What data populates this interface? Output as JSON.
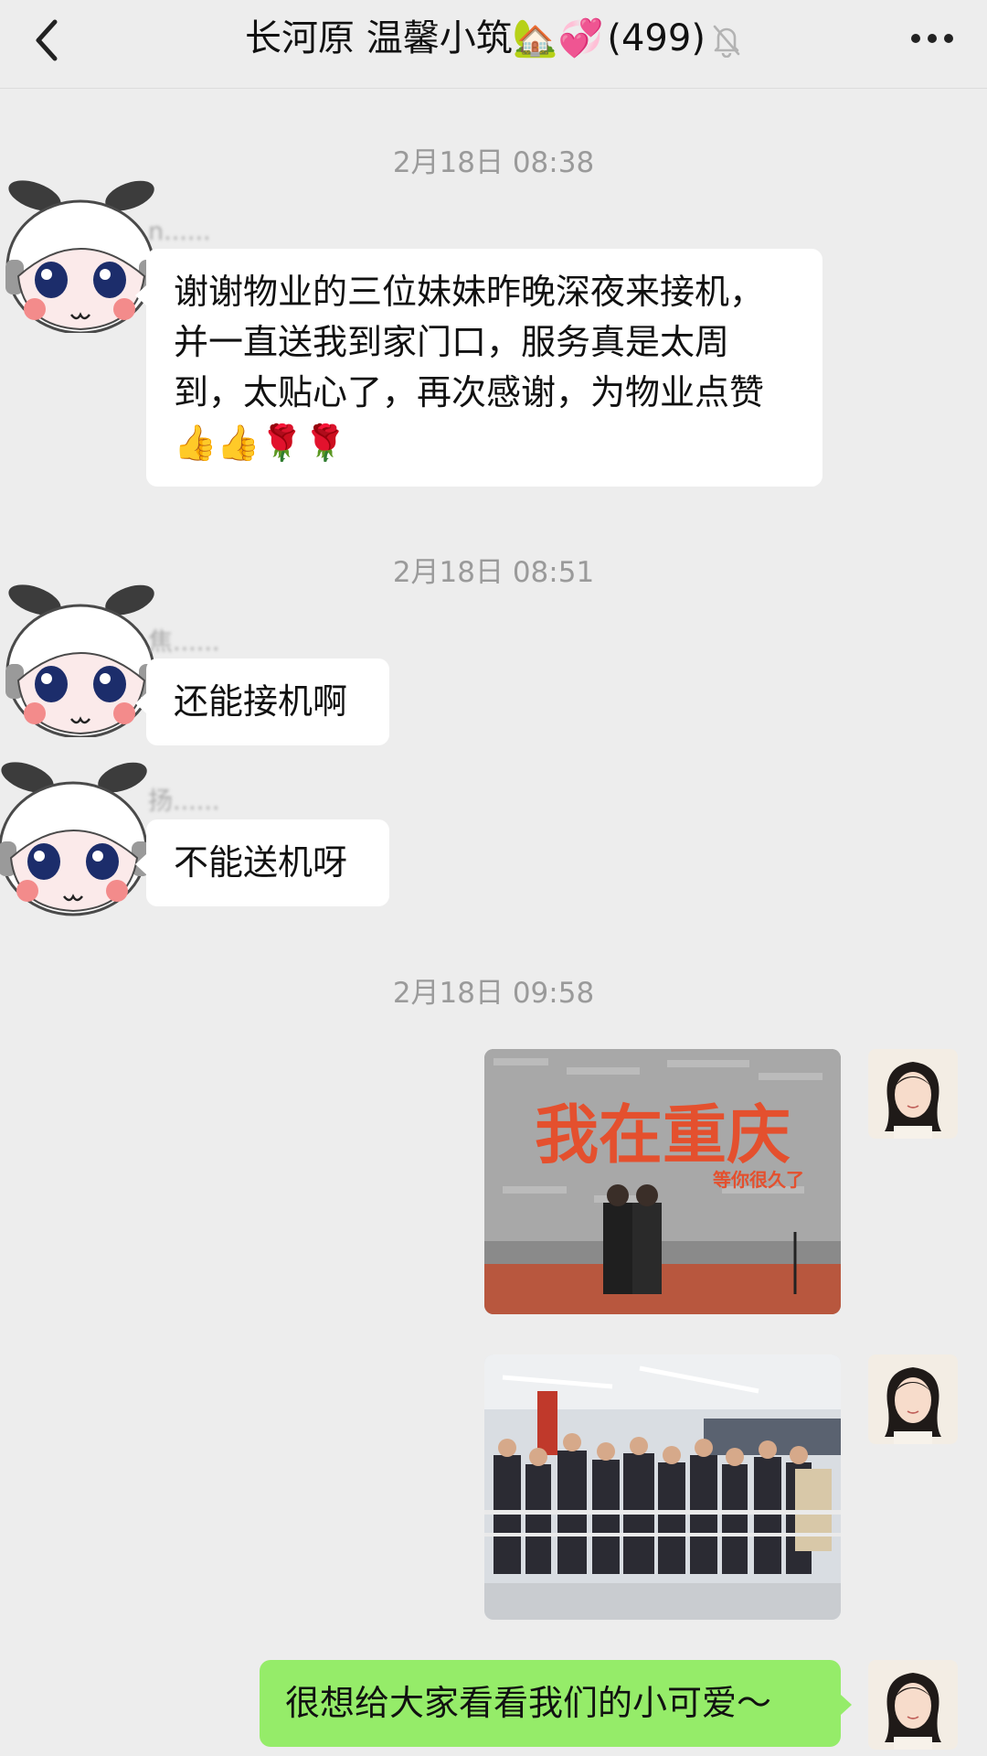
{
  "header": {
    "title": "长河原 温馨小筑🏡💞",
    "count": "(499)",
    "back_icon": "chevron-left-icon",
    "mute_icon": "bell-off-icon",
    "more_icon": "more-dots-icon"
  },
  "messages": {
    "ts1": "2月18日 08:38",
    "m1_sender": "n......",
    "m1_text": "谢谢物业的三位妹妹昨晚深夜来接机，并一直送我到家门口，服务真是太周到，太贴心了，再次感谢，为物业点赞👍👍🌹🌹",
    "ts2": "2月18日 08:51",
    "m2_sender": "焦......",
    "m2_text": "还能接机啊",
    "m3_sender": "扬......",
    "m3_text": "不能送机呀",
    "ts3": "2月18日 09:58",
    "photo1_caption": "我在重庆",
    "photo1_sub": "等你很久了",
    "m4_text": "很想给大家看看我们的小可爱～"
  },
  "colors": {
    "background": "#ededed",
    "bubble_white": "#ffffff",
    "bubble_green": "#95ec69",
    "timestamp": "#9a9a9a"
  }
}
